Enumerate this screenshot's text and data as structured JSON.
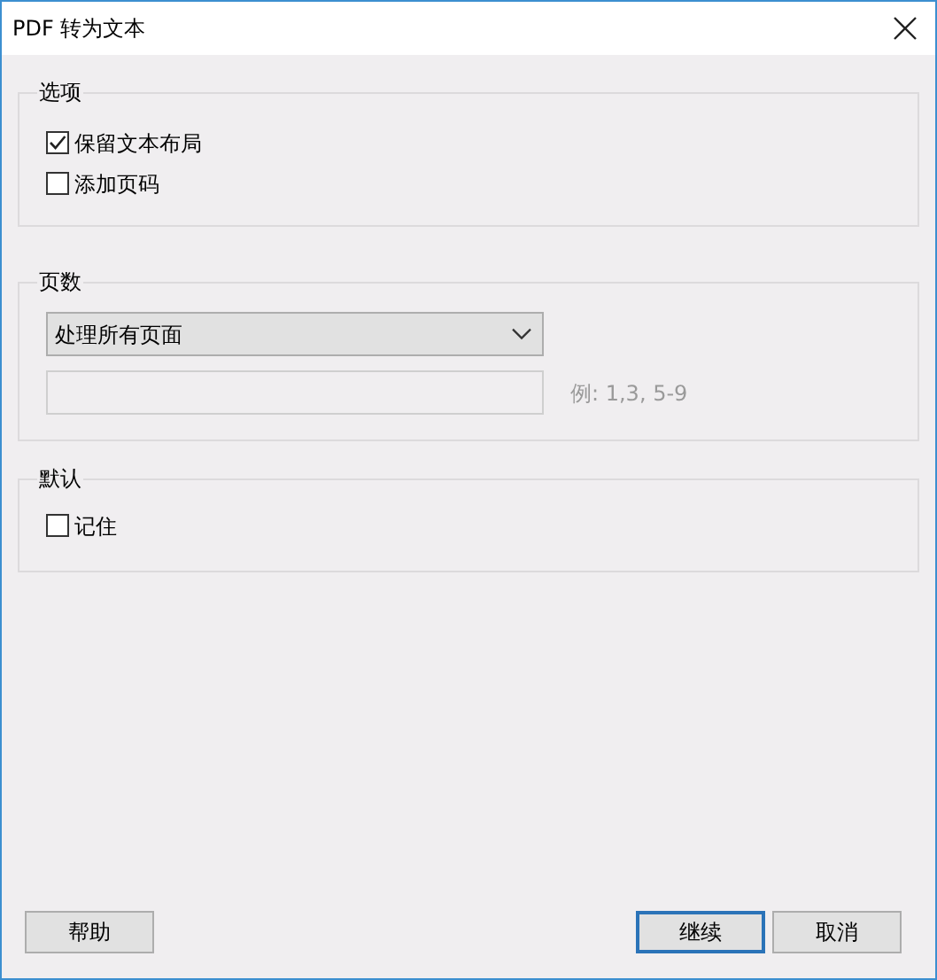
{
  "window": {
    "title": "PDF 转为文本"
  },
  "options": {
    "legend": "选项",
    "checkboxes": [
      {
        "label": "保留文本布局",
        "checked": true
      },
      {
        "label": "添加页码",
        "checked": false
      }
    ]
  },
  "pages": {
    "legend": "页数",
    "select": {
      "value": "处理所有页面"
    },
    "range_field": {
      "disabled": true
    },
    "hint": "例: 1,3, 5-9"
  },
  "defaults": {
    "legend": "默认",
    "checkboxes": [
      {
        "label": "记住",
        "checked": false
      }
    ]
  },
  "left_buttons": [
    {
      "label": "帮助",
      "focused": false
    }
  ],
  "right_buttons": [
    {
      "label": "继续",
      "focused": true
    },
    {
      "label": "取消",
      "focused": false
    }
  ]
}
